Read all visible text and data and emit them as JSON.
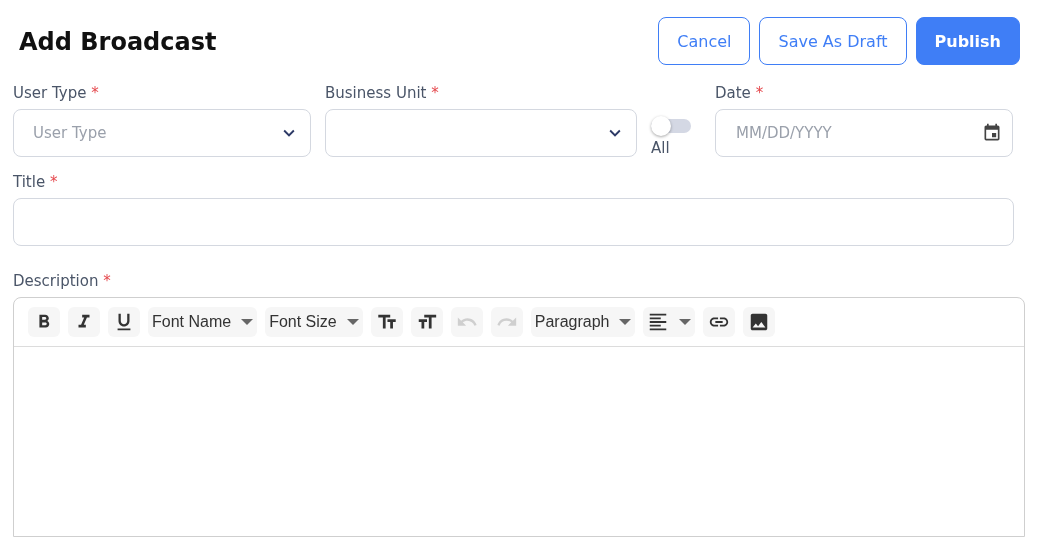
{
  "header": {
    "title": "Add Broadcast",
    "buttons": [
      {
        "label": "Cancel",
        "kind": "outline"
      },
      {
        "label": "Save As Draft",
        "kind": "outline"
      },
      {
        "label": "Publish",
        "kind": "primary"
      }
    ]
  },
  "fields": {
    "user_type": {
      "label": "User Type",
      "required_mark": "*",
      "placeholder": "User Type"
    },
    "business_unit": {
      "label": "Business Unit",
      "required_mark": "*"
    },
    "all_toggle": {
      "label": "All",
      "on": false
    },
    "date": {
      "label": "Date",
      "required_mark": "*",
      "placeholder": "MM/DD/YYYY"
    },
    "title": {
      "label": "Title",
      "required_mark": "*"
    }
  },
  "description": {
    "label": "Description",
    "required_mark": "*",
    "toolbar": [
      {
        "kind": "icon",
        "disabled": false
      },
      {
        "kind": "icon",
        "disabled": false
      },
      {
        "kind": "icon",
        "disabled": false
      },
      {
        "kind": "dropdown",
        "label": "Font Name",
        "disabled": false
      },
      {
        "kind": "dropdown",
        "label": "Font Size",
        "disabled": false
      },
      {
        "kind": "icon",
        "disabled": false
      },
      {
        "kind": "icon",
        "disabled": false
      },
      {
        "kind": "icon",
        "disabled": true
      },
      {
        "kind": "icon",
        "disabled": true
      },
      {
        "kind": "dropdown",
        "label": "Paragraph",
        "disabled": false
      },
      {
        "kind": "icon-dropdown",
        "disabled": false
      },
      {
        "kind": "icon",
        "disabled": false
      },
      {
        "kind": "icon",
        "disabled": false
      }
    ]
  }
}
